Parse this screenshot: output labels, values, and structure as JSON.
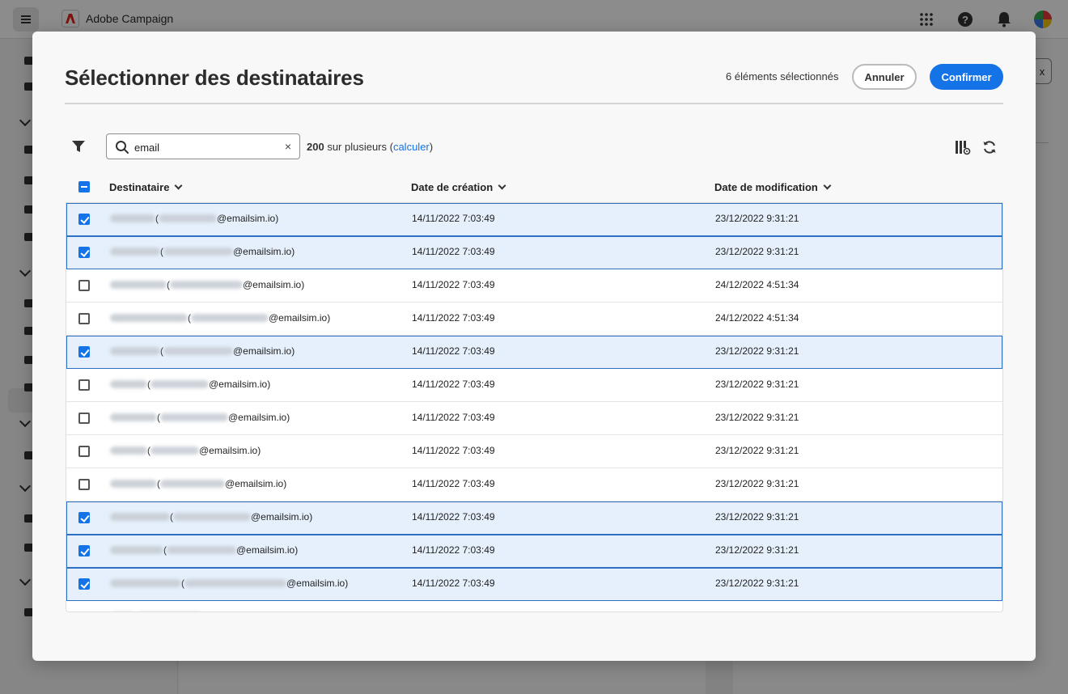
{
  "app": {
    "name": "Adobe Campaign",
    "background_button_label": "x"
  },
  "dialog": {
    "title": "Sélectionner des destinataires",
    "selected_count": "6 éléments sélectionnés",
    "cancel_label": "Annuler",
    "confirm_label": "Confirmer",
    "search": {
      "value": "email",
      "clear_label": "×"
    },
    "result_count": {
      "number": "200",
      "suffix": " sur plusieurs (",
      "link": "calculer",
      "close": ")"
    }
  },
  "table": {
    "columns": [
      {
        "label": "Destinataire"
      },
      {
        "label": "Date de création"
      },
      {
        "label": "Date de modification"
      }
    ],
    "rows": [
      {
        "selected": true,
        "domain": "@emailsim.io)",
        "created": "14/11/2022 7:03:49",
        "modified": "23/12/2022 9:31:21"
      },
      {
        "selected": true,
        "domain": "@emailsim.io)",
        "created": "14/11/2022 7:03:49",
        "modified": "23/12/2022 9:31:21"
      },
      {
        "selected": false,
        "domain": "@emailsim.io)",
        "created": "14/11/2022 7:03:49",
        "modified": "24/12/2022 4:51:34"
      },
      {
        "selected": false,
        "domain": "@emailsim.io)",
        "created": "14/11/2022 7:03:49",
        "modified": "24/12/2022 4:51:34"
      },
      {
        "selected": true,
        "domain": "@emailsim.io)",
        "created": "14/11/2022 7:03:49",
        "modified": "23/12/2022 9:31:21"
      },
      {
        "selected": false,
        "domain": "@emailsim.io)",
        "created": "14/11/2022 7:03:49",
        "modified": "23/12/2022 9:31:21"
      },
      {
        "selected": false,
        "domain": "@emailsim.io)",
        "created": "14/11/2022 7:03:49",
        "modified": "23/12/2022 9:31:21"
      },
      {
        "selected": false,
        "domain": "@emailsim.io)",
        "created": "14/11/2022 7:03:49",
        "modified": "23/12/2022 9:31:21"
      },
      {
        "selected": false,
        "domain": "@emailsim.io)",
        "created": "14/11/2022 7:03:49",
        "modified": "23/12/2022 9:31:21"
      },
      {
        "selected": true,
        "domain": "@emailsim.io)",
        "created": "14/11/2022 7:03:49",
        "modified": "23/12/2022 9:31:21"
      },
      {
        "selected": true,
        "domain": "@emailsim.io)",
        "created": "14/11/2022 7:03:49",
        "modified": "23/12/2022 9:31:21"
      },
      {
        "selected": true,
        "domain": "@emailsim.io)",
        "created": "14/11/2022 7:03:49",
        "modified": "23/12/2022 9:31:21"
      },
      {
        "selected": false,
        "domain": "",
        "created": "",
        "modified": ""
      }
    ]
  },
  "colors": {
    "accent": "#1473e6",
    "selected_row_bg": "#e5f0fc",
    "selected_row_border": "#2d6fc2"
  },
  "icons": {
    "menu": "hamburger-icon",
    "logo": "adobe-logo",
    "apps": "apps-grid-icon",
    "help": "help-icon",
    "notifications": "bell-icon",
    "filter": "filter-icon",
    "search": "search-icon",
    "clear": "close-icon",
    "columns": "column-settings-icon",
    "refresh": "refresh-icon"
  }
}
